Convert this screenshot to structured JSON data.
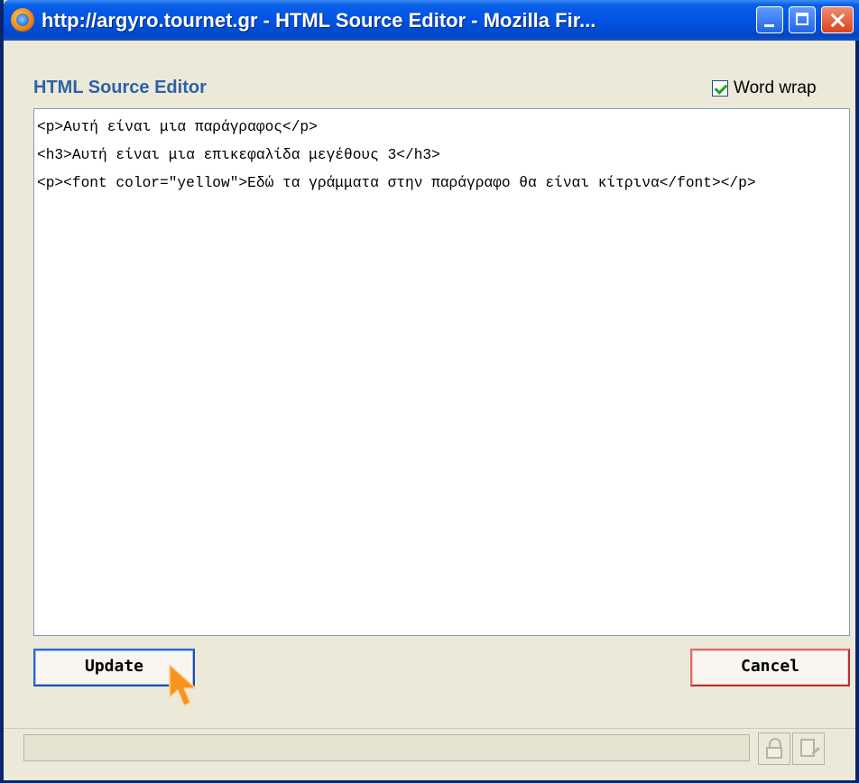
{
  "window": {
    "title": "http://argyro.tournet.gr - HTML Source Editor - Mozilla Fir..."
  },
  "editor": {
    "heading": "HTML Source Editor",
    "word_wrap": {
      "label": "Word wrap",
      "checked": true
    },
    "content": "<p>Αυτή είναι μια παράγραφος</p>\n<h3>Αυτή είναι μια επικεφαλίδα μεγέθους 3</h3>\n<p><font color=\"yellow\">Εδώ τα γράμματα στην παράγραφο θα είναι κίτρινα</font></p>"
  },
  "buttons": {
    "update_label": "Update",
    "cancel_label": "Cancel"
  },
  "icons": {
    "app": "firefox-icon",
    "cursor": "mouse-pointer-icon",
    "status": [
      "lock-icon",
      "page-icon"
    ]
  },
  "colors": {
    "titlebar": "#0054e3",
    "heading": "#2b63a8",
    "update_border": "#2868d8",
    "cancel_border": "#e16a6a",
    "cursor": "#f7941d"
  }
}
